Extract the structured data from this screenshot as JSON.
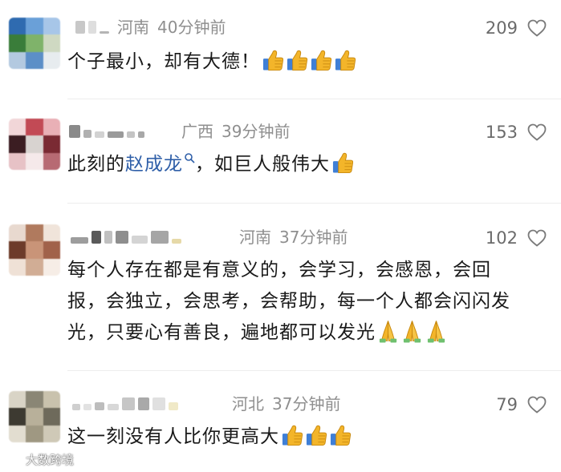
{
  "comments": [
    {
      "location": "河南",
      "time": "40分钟前",
      "likes": "209",
      "text": "个子最小，却有大德！",
      "emoji_count": 4,
      "emoji": "thumbs-up",
      "avatar_colors": [
        "#2f6bb0",
        "#6aa0d8",
        "#a7c6e8",
        "#3a7d3a",
        "#7fb36a",
        "#cfd9c2",
        "#b3c9e0",
        "#5c8fc7",
        "#e7ecef"
      ]
    },
    {
      "location": "广西",
      "time": "39分钟前",
      "likes": "153",
      "text_before": "此刻的",
      "mention": "赵成龙",
      "text_after": "，如巨人般伟大",
      "emoji_count": 1,
      "emoji": "thumbs-up",
      "avatar_colors": [
        "#f1d6d8",
        "#c24a55",
        "#e9b0b6",
        "#3b1d22",
        "#d8d3d0",
        "#7a2a33",
        "#e7c2c6",
        "#f5e9ea",
        "#b76a73"
      ]
    },
    {
      "location": "河南",
      "time": "37分钟前",
      "likes": "102",
      "text": "每个人存在都是有意义的，会学习，会感恩，会回报，会独立，会思考，会帮助，每一个人都会闪闪发光，只要心有善良，遍地都可以发光",
      "emoji_count": 3,
      "emoji": "folded-hands",
      "avatar_colors": [
        "#e8d9cf",
        "#b07a5e",
        "#f0e4da",
        "#6d3b2a",
        "#c99478",
        "#a1624a",
        "#efe1d6",
        "#d1ad95",
        "#f6ede6"
      ]
    },
    {
      "location": "河北",
      "time": "37分钟前",
      "likes": "79",
      "text": "这一刻没有人比你更高大",
      "emoji_count": 3,
      "emoji": "thumbs-up",
      "avatar_colors": [
        "#d9d4c6",
        "#8a8675",
        "#c9c2ad",
        "#3d3a31",
        "#b8b09a",
        "#6e6a5b",
        "#e2ddd0",
        "#9f9882",
        "#cfc9b7"
      ]
    }
  ],
  "watermark": {
    "text": "大数跨境",
    "icon": "weibo-logo-icon"
  },
  "icons": {
    "like": "heart-outline-icon",
    "mention_tag": "search-icon"
  },
  "colors": {
    "meta": "#8f8f8f",
    "text": "#1a1a1a",
    "mention": "#2f5fa8",
    "thumb": "#f3b52a",
    "cuff": "#3f7fd6"
  }
}
